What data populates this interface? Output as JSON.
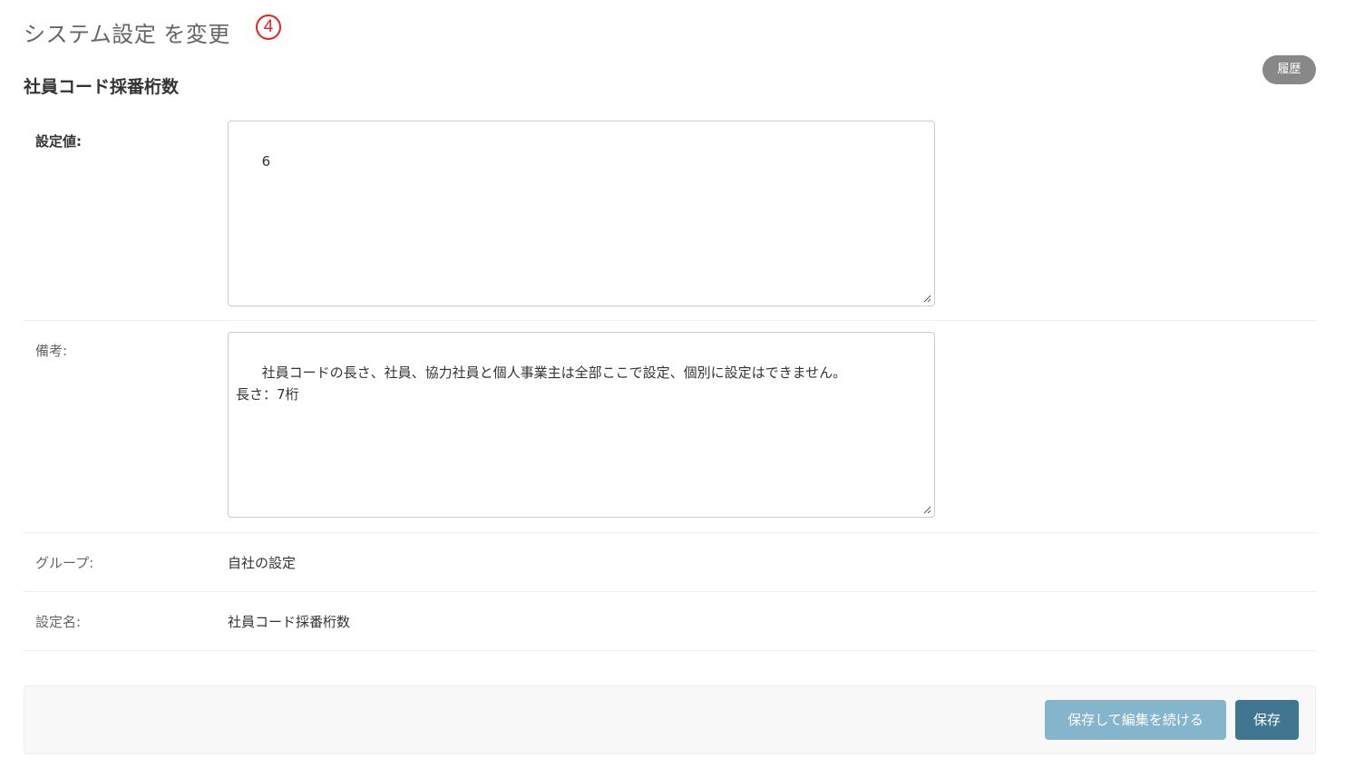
{
  "header": {
    "title": "システム設定 を変更",
    "step_marker": "4",
    "history_label": "履歴"
  },
  "object": {
    "heading": "社員コード採番桁数"
  },
  "fields": {
    "value": {
      "label": "設定値:",
      "content": "6"
    },
    "notes": {
      "label": "備考:",
      "content": "社員コードの長さ、社員、協力社員と個人事業主は全部ここで設定、個別に設定はできません。\n長さ：7桁"
    },
    "group": {
      "label": "グループ:",
      "value": "自社の設定"
    },
    "name": {
      "label": "設定名:",
      "value": "社員コード採番桁数"
    }
  },
  "actions": {
    "save_continue_label": "保存して編集を続ける",
    "save_label": "保存"
  },
  "colors": {
    "step_marker": "#e8211c",
    "history_button": "#888888",
    "save_button": "#417690",
    "save_continue_button": "#79aec8"
  },
  "icons": {
    "resize": "resize-grip-icon"
  }
}
